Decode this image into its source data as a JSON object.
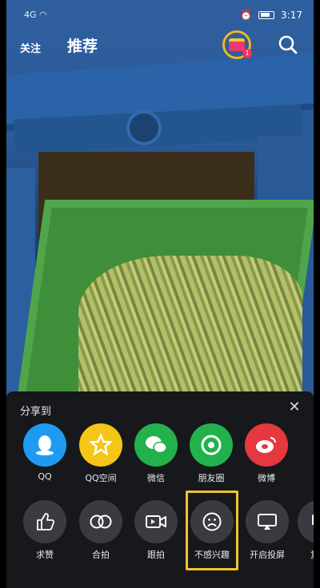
{
  "status_bar": {
    "signal": "4G",
    "time": "3:17",
    "icons": [
      "signal-icon",
      "wifi-icon",
      "alarm-icon",
      "battery-icon"
    ]
  },
  "top_nav": {
    "follow_tab": "关注",
    "recommend_tab": "推荐",
    "gift_badge": "1",
    "icons": [
      "gift-icon",
      "search-icon"
    ]
  },
  "share_sheet": {
    "title": "分享到",
    "close_icon": "close-icon",
    "share_targets": [
      {
        "label": "QQ",
        "icon": "qq-icon",
        "color": "#1e9bf0"
      },
      {
        "label": "QQ空间",
        "icon": "qzone-icon",
        "color": "#f5c518"
      },
      {
        "label": "微信",
        "icon": "wechat-icon",
        "color": "#22b14c"
      },
      {
        "label": "朋友圈",
        "icon": "moments-icon",
        "color": "#22b14c"
      },
      {
        "label": "微博",
        "icon": "weibo-icon",
        "color": "#e6383f"
      }
    ],
    "actions": [
      {
        "label": "求赞",
        "icon": "thumbs-up-icon"
      },
      {
        "label": "合拍",
        "icon": "duet-icon"
      },
      {
        "label": "跟拍",
        "icon": "video-camera-icon"
      },
      {
        "label": "不感兴趣",
        "icon": "sad-face-icon"
      },
      {
        "label": "开启投屏",
        "icon": "cast-screen-icon"
      },
      {
        "label": "复制",
        "icon": "copy-icon"
      }
    ]
  },
  "colors": {
    "sheet_background": "#17181c",
    "highlight": "#f2c230"
  }
}
